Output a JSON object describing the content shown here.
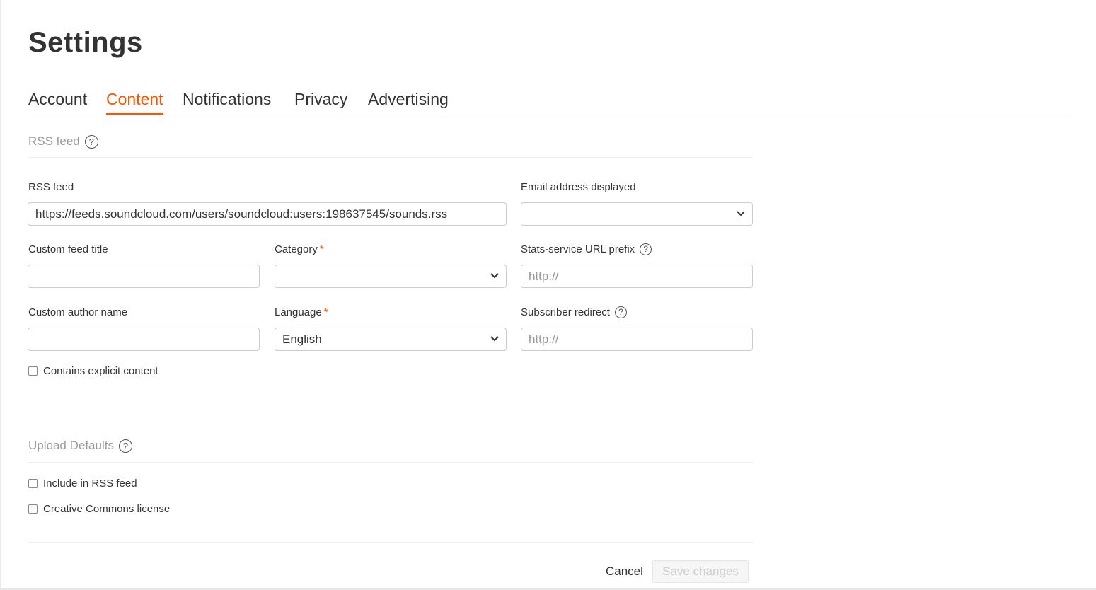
{
  "page": {
    "title": "Settings"
  },
  "tabs": [
    {
      "label": "Account",
      "active": false
    },
    {
      "label": "Content",
      "active": true
    },
    {
      "label": "Notifications",
      "active": false
    },
    {
      "label": "Privacy",
      "active": false
    },
    {
      "label": "Advertising",
      "active": false
    }
  ],
  "rss_section": {
    "title": "RSS feed",
    "fields": {
      "rss_feed": {
        "label": "RSS feed",
        "value": "https://feeds.soundcloud.com/users/soundcloud:users:198637545/sounds.rss"
      },
      "email_displayed": {
        "label": "Email address displayed",
        "value": ""
      },
      "custom_feed_title": {
        "label": "Custom feed title",
        "value": ""
      },
      "category": {
        "label": "Category",
        "required_mark": "*",
        "value": ""
      },
      "stats_prefix": {
        "label": "Stats-service URL prefix",
        "placeholder": "http://"
      },
      "custom_author": {
        "label": "Custom author name",
        "value": ""
      },
      "language": {
        "label": "Language",
        "required_mark": "*",
        "value": "English"
      },
      "subscriber_redirect": {
        "label": "Subscriber redirect",
        "placeholder": "http://"
      }
    },
    "explicit_checkbox": {
      "label": "Contains explicit content",
      "checked": false
    }
  },
  "upload_defaults": {
    "title": "Upload Defaults",
    "include_rss": {
      "label": "Include in RSS feed",
      "checked": false
    },
    "creative_commons": {
      "label": "Creative Commons license",
      "checked": false
    }
  },
  "footer": {
    "cancel_label": "Cancel",
    "save_label": "Save changes"
  },
  "icons": {
    "help": "help-circle-icon",
    "chevron": "chevron-down-icon"
  },
  "colors": {
    "accent": "#ff5500",
    "muted": "#999999",
    "text": "#333333",
    "border": "#cccccc"
  }
}
